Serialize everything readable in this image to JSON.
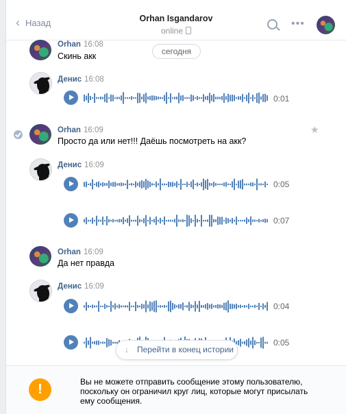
{
  "header": {
    "back_label": "Назад",
    "title": "Orhan Isgandarov",
    "status": "online"
  },
  "date_separator": "сегодня",
  "messages": [
    {
      "sender": "Orhan",
      "time": "16:08",
      "text": "Скинь акк",
      "avatar": "orhan"
    },
    {
      "sender": "Денис",
      "time": "16:08",
      "avatar": "denis",
      "voice": [
        "0:01"
      ]
    },
    {
      "sender": "Orhan",
      "time": "16:09",
      "text": "Просто да или нет!!! Даёшь посмотреть на акк?",
      "avatar": "orhan",
      "selected": true
    },
    {
      "sender": "Денис",
      "time": "16:09",
      "avatar": "denis",
      "voice": [
        "0:05",
        "0:07"
      ]
    },
    {
      "sender": "Orhan",
      "time": "16:09",
      "text": "Да нет правда",
      "avatar": "orhan"
    },
    {
      "sender": "Денис",
      "time": "16:09",
      "avatar": "denis",
      "voice": [
        "0:04",
        "0:05"
      ]
    }
  ],
  "jump_button": "Перейти в конец истории",
  "footer": {
    "notice": "Вы не можете отправить сообщение этому пользователю, поскольку он ограничил круг лиц, которые могут присылать ему сообщения."
  },
  "colors": {
    "accent": "#5181b8",
    "sender": "#42648b",
    "warning": "#ffa000"
  },
  "icons": [
    "chevron-left-icon",
    "phone-icon",
    "search-icon",
    "more-icon",
    "play-icon",
    "check-icon",
    "star-icon",
    "arrow-down-icon",
    "warning-icon"
  ]
}
